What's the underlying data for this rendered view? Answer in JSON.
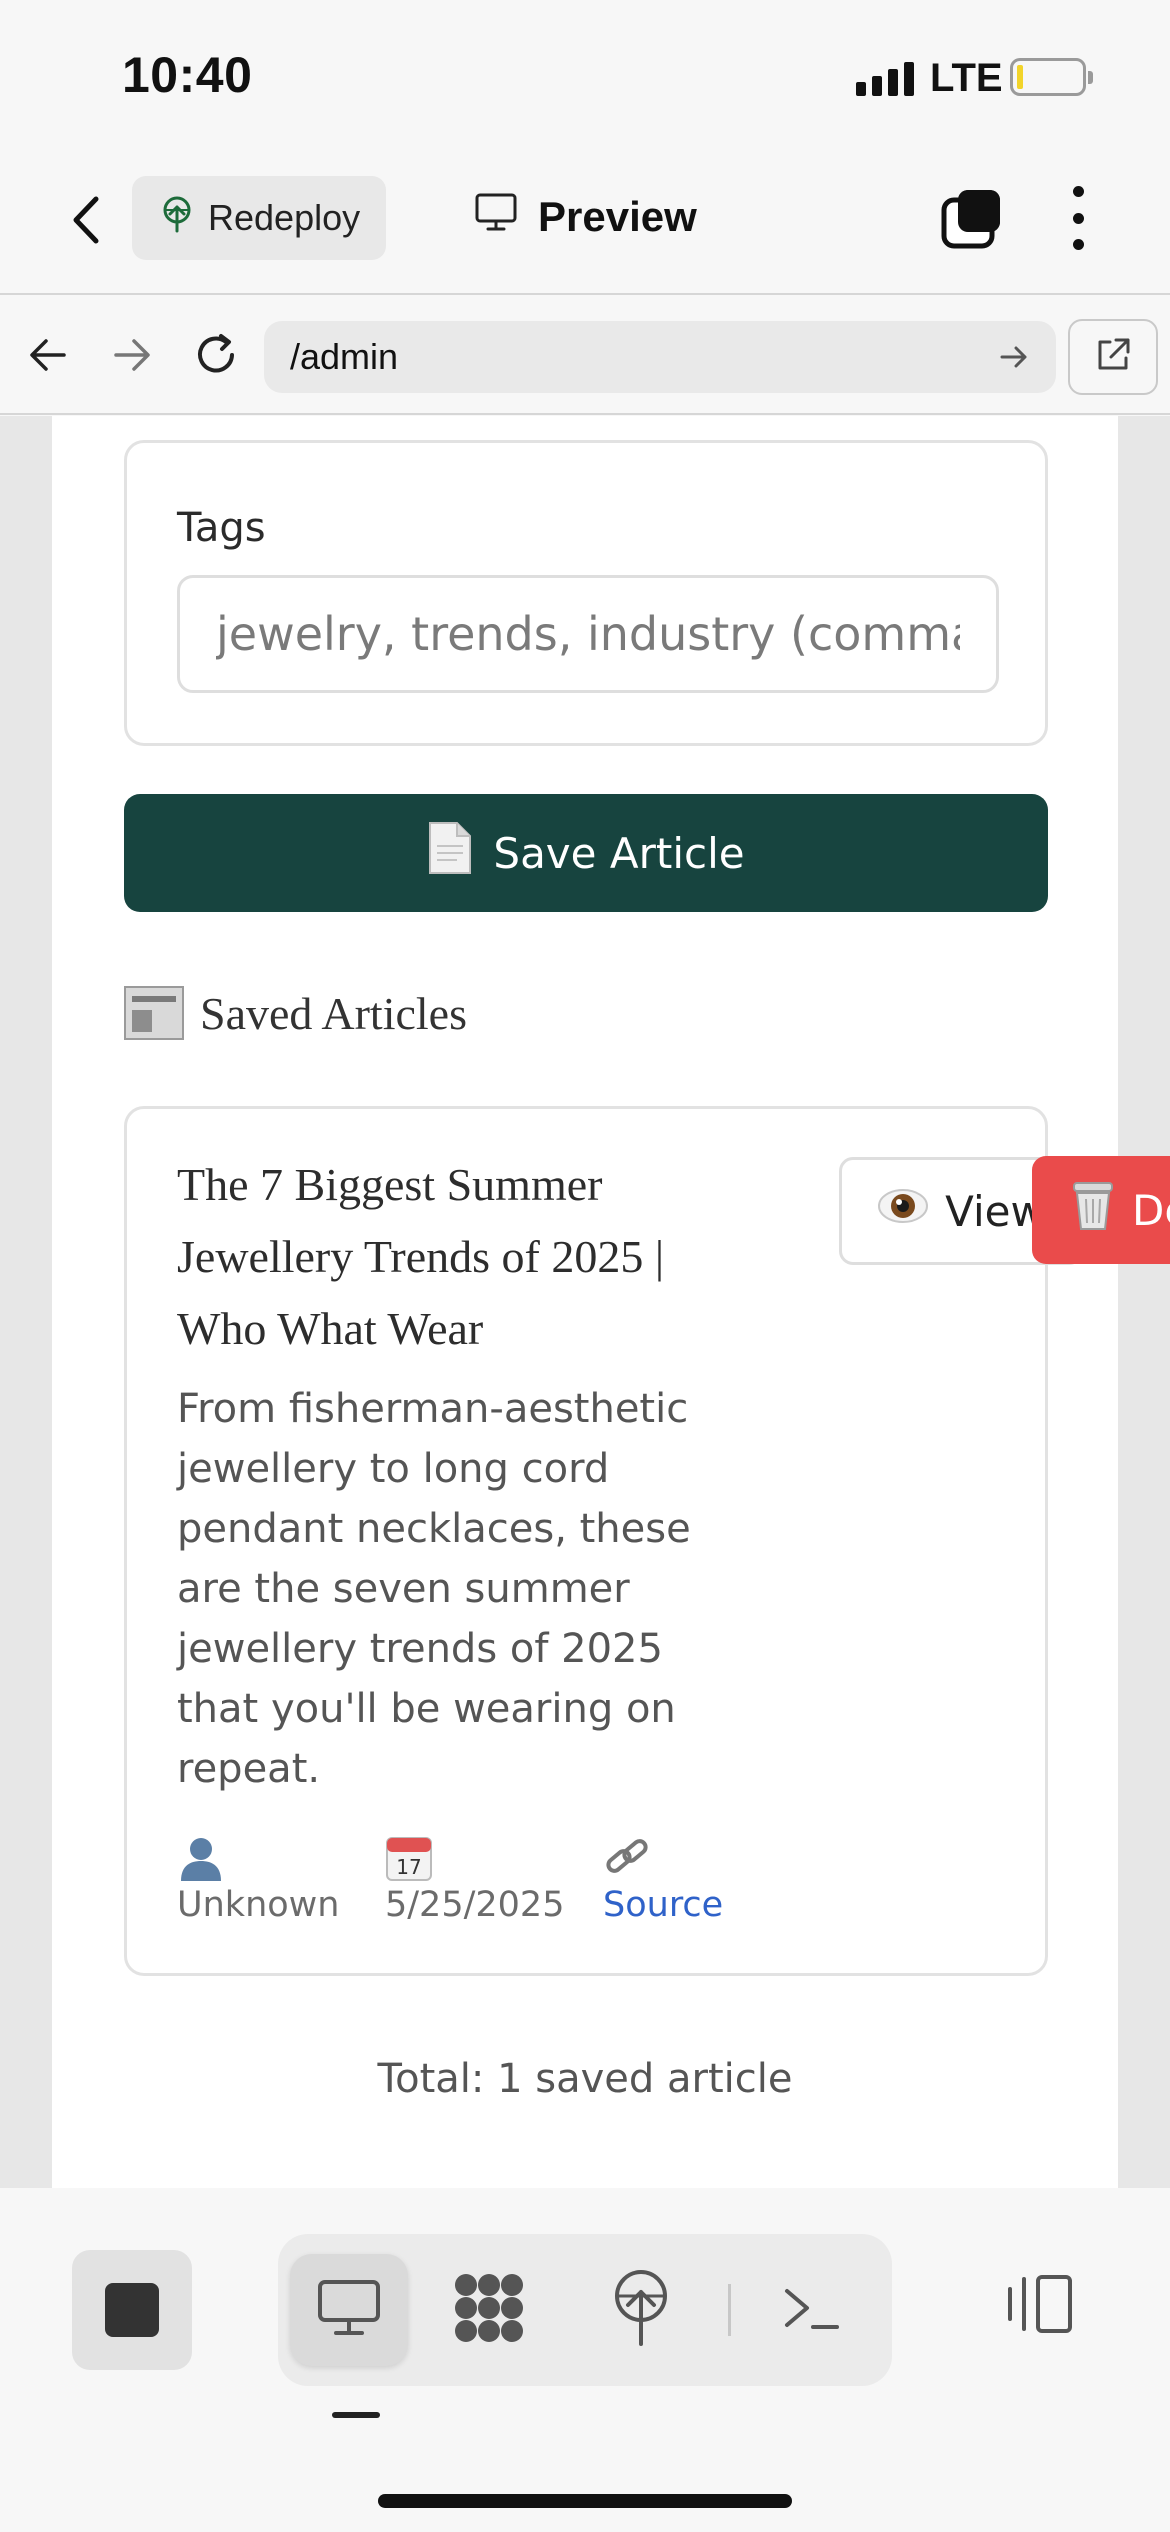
{
  "status_bar": {
    "time": "10:40",
    "network": "LTE"
  },
  "app_header": {
    "redeploy_label": "Redeploy",
    "preview_label": "Preview",
    "icons": [
      "chevron-left-icon",
      "redeploy-icon",
      "monitor-icon",
      "tabs-icon",
      "more-vertical-icon"
    ]
  },
  "browser": {
    "url": "/admin",
    "icons": [
      "arrow-left-icon",
      "arrow-right-icon",
      "reload-icon",
      "arrow-go-icon",
      "external-link-icon"
    ]
  },
  "tags_section": {
    "label": "Tags",
    "placeholder": "jewelry, trends, industry (comma separated)",
    "value": ""
  },
  "save_button": {
    "icon": "page-icon",
    "label": "Save Article"
  },
  "saved_articles": {
    "icon": "newspaper-icon",
    "heading": "Saved Articles",
    "items": [
      {
        "title": "The 7 Biggest Summer Jewellery Trends of 2025 | Who What Wear",
        "description": "From fisherman-aesthetic jewellery to long cord pendant necklaces, these are the seven summer jewellery trends of 2025 that you'll be wearing on repeat.",
        "author_icon": "person-icon",
        "author": "Unknown",
        "date_icon": "calendar-icon",
        "date": "5/25/2025",
        "source_icon": "link-icon",
        "source_label": "Source",
        "view_label": "View",
        "view_icon": "eye-icon",
        "delete_label": "Delete",
        "delete_icon": "trash-icon"
      }
    ],
    "total": "Total: 1 saved article"
  },
  "toolbar": {
    "icons": [
      "stop-icon",
      "desktop-icon",
      "grid-blob-icon",
      "deploy-icon",
      "terminal-icon",
      "panel-toggle-icon"
    ],
    "active_tool": "desktop"
  },
  "colors": {
    "save_button": "#17443f",
    "delete_button": "#ea4b4b",
    "link": "#2f62c9",
    "background": "#f7f7f7"
  }
}
